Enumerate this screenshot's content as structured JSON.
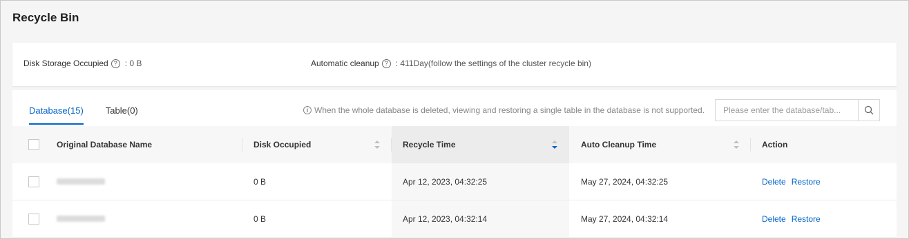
{
  "page": {
    "title": "Recycle Bin"
  },
  "summary": {
    "storage_label": "Disk Storage Occupied",
    "storage_value": "0 B",
    "cleanup_label": "Automatic cleanup",
    "cleanup_value": "411Day(follow the settings of the cluster recycle bin)"
  },
  "tabs": [
    {
      "label": "Database(15)",
      "active": true
    },
    {
      "label": "Table(0)",
      "active": false
    }
  ],
  "notice": "When the whole database is deleted, viewing and restoring a single table in the database is not supported.",
  "search": {
    "placeholder": "Please enter the database/tab..."
  },
  "table": {
    "columns": [
      "Original Database Name",
      "Disk Occupied",
      "Recycle Time",
      "Auto Cleanup Time",
      "Action"
    ],
    "rows": [
      {
        "name": "",
        "disk": "0 B",
        "recycle_time": "Apr 12, 2023, 04:32:25",
        "cleanup_time": "May 27, 2024, 04:32:25",
        "actions": [
          "Delete",
          "Restore"
        ]
      },
      {
        "name": "",
        "disk": "0 B",
        "recycle_time": "Apr 12, 2023, 04:32:14",
        "cleanup_time": "May 27, 2024, 04:32:14",
        "actions": [
          "Delete",
          "Restore"
        ]
      }
    ]
  },
  "colors": {
    "accent": "#0064c8",
    "sort_active": "#0064c8"
  }
}
